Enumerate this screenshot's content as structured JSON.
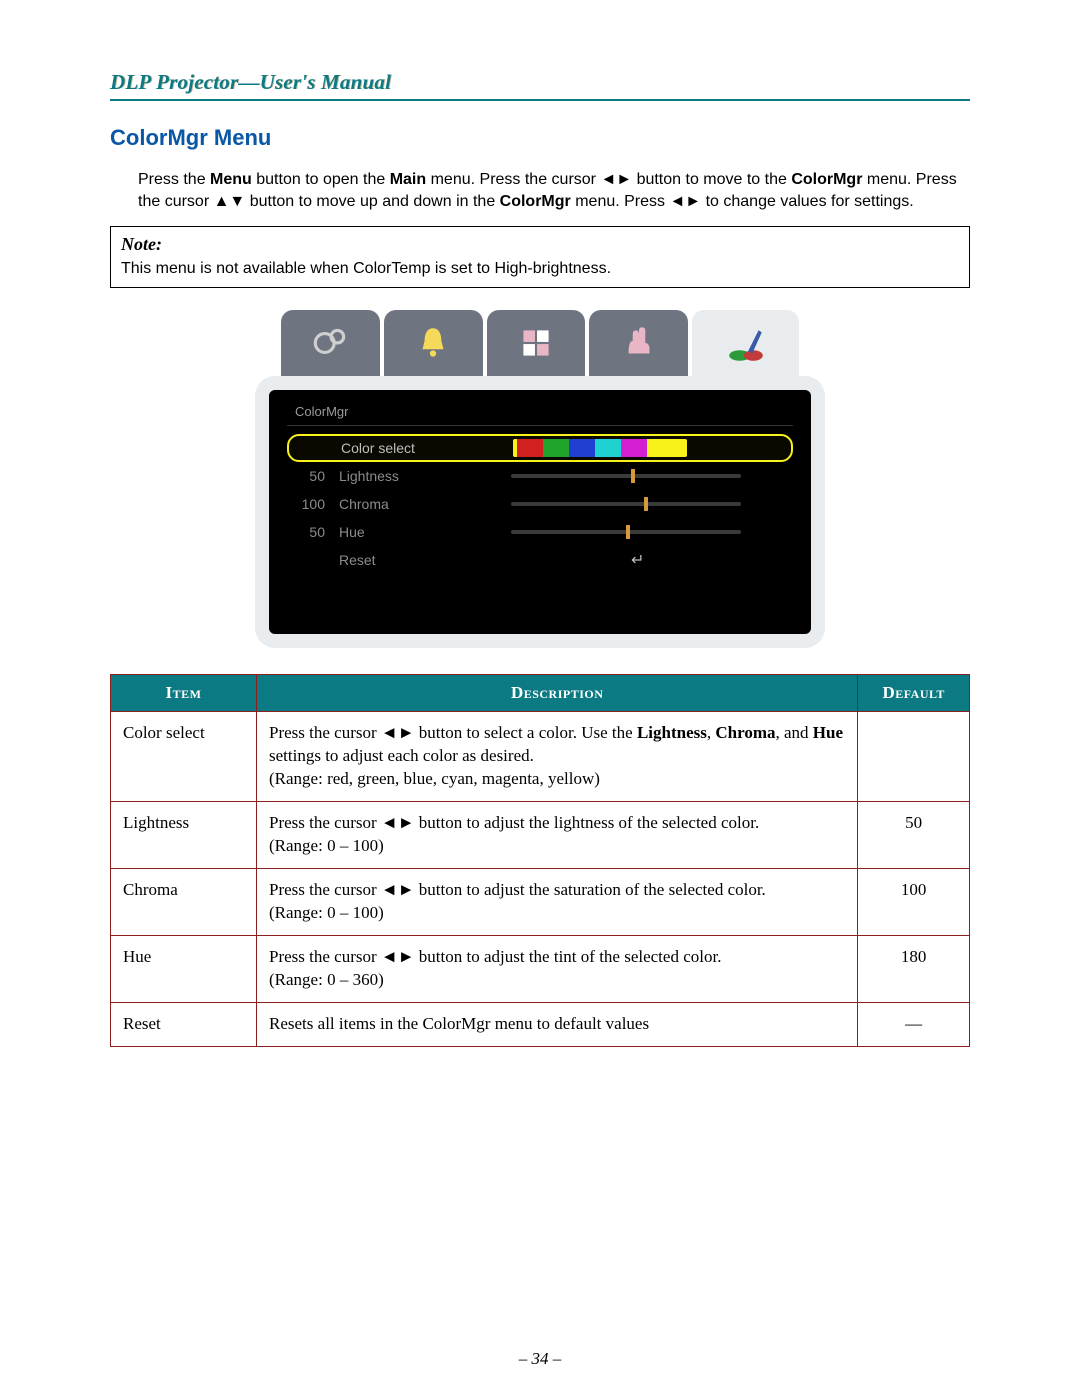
{
  "header": {
    "title": "DLP Projector—User's Manual"
  },
  "section": {
    "title": "ColorMgr Menu"
  },
  "intro": {
    "p1a": "Press the ",
    "b1": "Menu",
    "p1b": " button to open the ",
    "b2": "Main",
    "p1c": " menu. Press the cursor ◄► button to move to the ",
    "b3": "ColorMgr",
    "p1d": " menu. Press the cursor ▲▼ button to move up and down in the ",
    "b4": "ColorMgr",
    "p1e": " menu. Press ◄► to change values for settings."
  },
  "note": {
    "label": "Note:",
    "text": "This menu is not available when ColorTemp is set to High-brightness."
  },
  "osd": {
    "title": "ColorMgr",
    "rows": [
      {
        "val": "",
        "label": "Color select",
        "type": "chips",
        "selected": true
      },
      {
        "val": "50",
        "label": "Lightness",
        "type": "slider",
        "pos": 50
      },
      {
        "val": "100",
        "label": "Chroma",
        "type": "slider",
        "pos": 60
      },
      {
        "val": "50",
        "label": "Hue",
        "type": "slider",
        "pos": 50
      },
      {
        "val": "",
        "label": "Reset",
        "type": "enter"
      }
    ],
    "chip_colors": [
      "#d21f1f",
      "#1fa32a",
      "#1f3fd2",
      "#1fd2d2",
      "#d21fd2"
    ]
  },
  "table": {
    "headers": {
      "item": "Item",
      "desc": "Description",
      "def": "Default"
    },
    "rows": [
      {
        "item": "Color select",
        "desc_a": "Press the cursor ◄► button to select a color. Use the ",
        "b1": "Lightness",
        "desc_b": ", ",
        "b2": "Chroma",
        "desc_c": ", and ",
        "b3": "Hue",
        "desc_d": " settings to adjust each color as desired.",
        "range": "(Range: red, green, blue, cyan, magenta, yellow)",
        "def": ""
      },
      {
        "item": "Lightness",
        "desc_a": "Press the cursor ◄► button to adjust the lightness of the selected color.",
        "range": "(Range: 0 – 100)",
        "def": "50"
      },
      {
        "item": "Chroma",
        "desc_a": "Press the cursor ◄► button to adjust the saturation of the selected color.",
        "range": "(Range: 0 – 100)",
        "def": "100"
      },
      {
        "item": "Hue",
        "desc_a": "Press the cursor ◄► button to adjust the tint of the selected color.",
        "range": "(Range: 0 – 360)",
        "def": "180"
      },
      {
        "item": "Reset",
        "desc_a": "Resets all items in the ColorMgr menu to default values",
        "range": "",
        "def": "—"
      }
    ]
  },
  "footer": {
    "page": "– 34 –"
  }
}
